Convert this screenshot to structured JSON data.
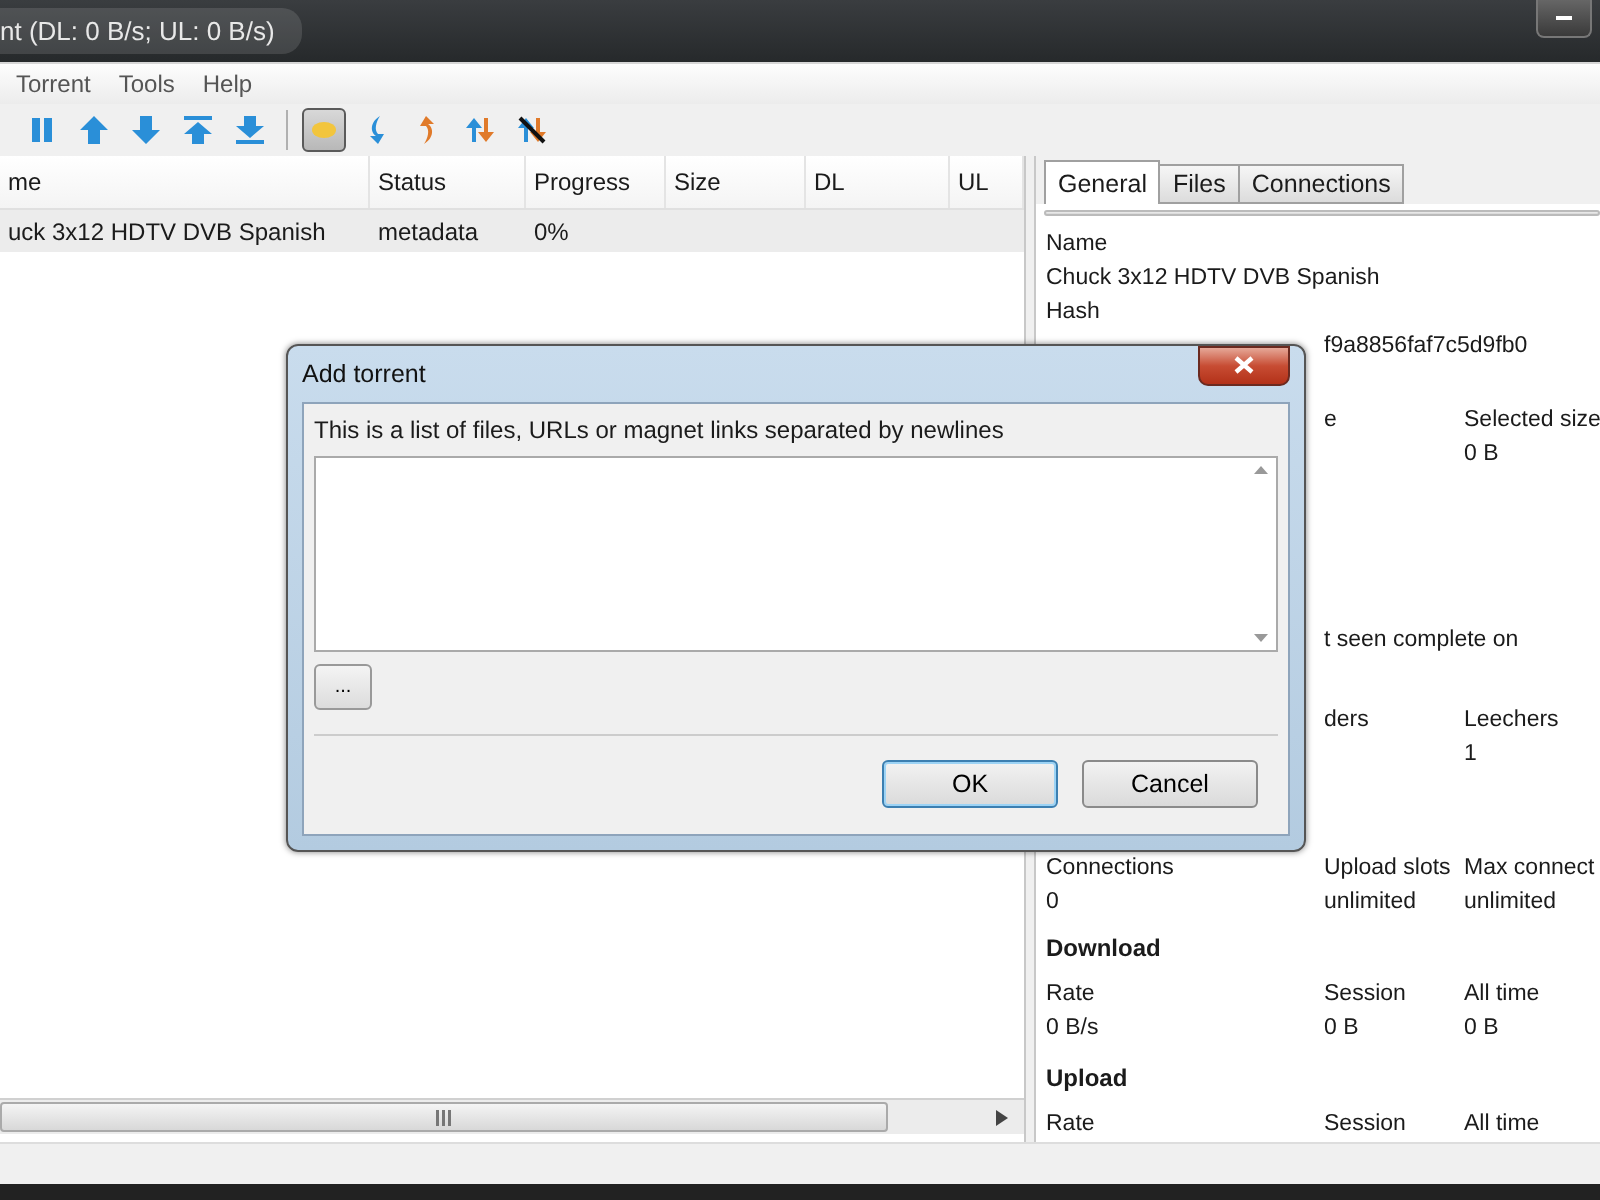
{
  "window": {
    "title": "nt (DL: 0 B/s; UL: 0 B/s)"
  },
  "menu": [
    "Torrent",
    "Tools",
    "Help"
  ],
  "toolbar": [
    {
      "kind": "pause",
      "selected": false
    },
    {
      "kind": "up",
      "selected": false
    },
    {
      "kind": "down",
      "selected": false
    },
    {
      "kind": "top",
      "selected": false
    },
    {
      "kind": "bottom",
      "selected": false
    },
    {
      "kind": "separator"
    },
    {
      "kind": "note",
      "selected": true
    },
    {
      "kind": "curve-down",
      "selected": false
    },
    {
      "kind": "curve-up",
      "selected": false
    },
    {
      "kind": "swap",
      "selected": false
    },
    {
      "kind": "crossed",
      "selected": false
    }
  ],
  "table": {
    "columns": [
      "me",
      "Status",
      "Progress",
      "Size",
      "DL",
      "UL"
    ],
    "rows": [
      {
        "cells": [
          "uck 3x12 HDTV DVB Spanish",
          "metadata",
          "0%",
          "",
          "",
          ""
        ],
        "selected": true
      }
    ]
  },
  "details": {
    "tabs": [
      {
        "label": "General",
        "selected": true
      },
      {
        "label": "Files",
        "selected": false
      },
      {
        "label": "Connections",
        "selected": false
      }
    ],
    "progress": {
      "level": 0
    },
    "sections": [
      {
        "kind": "grid",
        "lines": [
          {
            "column_1": "Name"
          },
          {
            "column_1": "Chuck 3x12 HDTV DVB Spanish"
          }
        ]
      },
      {
        "kind": "grid",
        "lines": [
          {
            "column_1": "Hash"
          },
          {
            "column_2": "f9a8856faf7c5d9fb0"
          }
        ]
      },
      {
        "kind": "grid",
        "lines": [
          {
            "column_2": "e",
            "column_3": "Selected size"
          },
          {
            "column_3": "0 B"
          }
        ]
      },
      {
        "kind": "grid",
        "lines": [
          {
            "column_2": "t seen complete on"
          }
        ]
      },
      {
        "kind": "grid",
        "lines": [
          {
            "column_2": "ders",
            "column_3": "Leechers"
          },
          {
            "column_3": "1"
          }
        ]
      },
      {
        "kind": "grid",
        "lines": [
          {
            "column_1": "Connections",
            "column_2": "Upload slots",
            "column_3": "Max connect"
          },
          {
            "column_1": "0",
            "column_2": "unlimited",
            "column_3": "unlimited"
          }
        ]
      },
      {
        "kind": "heading",
        "text": "Download"
      },
      {
        "kind": "grid",
        "lines": [
          {
            "column_1": "Rate",
            "column_2": "Session",
            "column_3": "All time"
          },
          {
            "column_1": "0 B/s",
            "column_2": "0 B",
            "column_3": "0 B"
          }
        ]
      },
      {
        "kind": "heading",
        "text": "Upload"
      },
      {
        "kind": "grid",
        "lines": [
          {
            "column_1": "Rate",
            "column_2": "Session",
            "column_3": "All time"
          }
        ]
      }
    ]
  },
  "dialog": {
    "title": "Add torrent",
    "label": "This is a list of files, URLs or magnet links separated by newlines",
    "browse": "...",
    "buttons": [
      {
        "label": "OK",
        "selected": true
      },
      {
        "label": "Cancel",
        "selected": false
      }
    ]
  }
}
